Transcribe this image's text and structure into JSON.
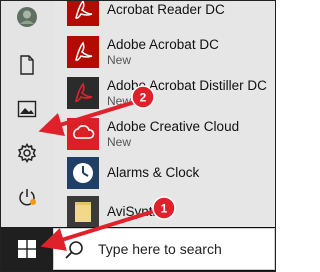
{
  "apps": [
    {
      "name": "Acrobat Reader DC",
      "icon": "acrobat-reader-icon"
    },
    {
      "name": "Adobe Acrobat DC",
      "sub": "New",
      "icon": "acrobat-icon"
    },
    {
      "name": "Adobe Acrobat Distiller DC",
      "sub": "New",
      "icon": "acrobat-distiller-icon"
    },
    {
      "name": "Adobe Creative Cloud",
      "sub": "New",
      "icon": "creative-cloud-icon"
    },
    {
      "name": "Alarms & Clock",
      "icon": "alarms-clock-icon"
    },
    {
      "name": "AviSynth",
      "icon": "folder-icon"
    }
  ],
  "rail": {
    "items": [
      "user-avatar",
      "documents-icon",
      "pictures-icon",
      "settings-icon",
      "power-icon"
    ]
  },
  "taskbar": {
    "start_icon": "windows-logo-icon",
    "search_placeholder": "Type here to search"
  },
  "callouts": [
    {
      "number": "1",
      "target": "start-button"
    },
    {
      "number": "2",
      "target": "settings-button"
    }
  ],
  "colors": {
    "callout_red": "#e0202a",
    "acrobat_red": "#b30b00",
    "taskbar": "#101010",
    "menu_bg": "#e6e6e6"
  }
}
